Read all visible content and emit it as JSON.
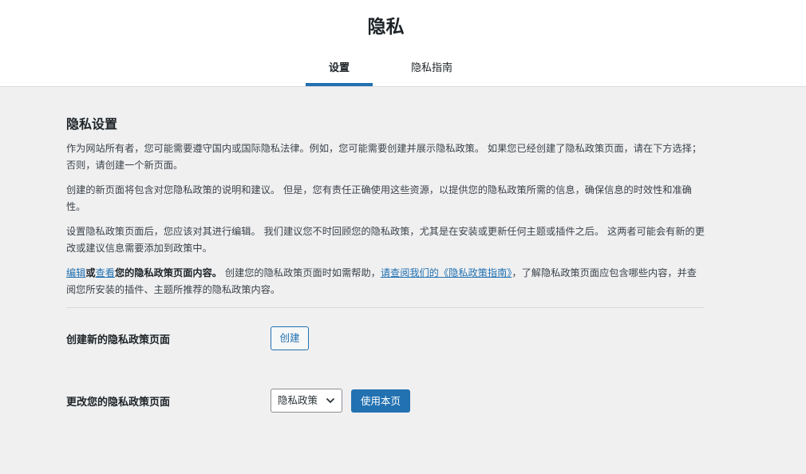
{
  "header": {
    "title": "隐私",
    "tabs": [
      {
        "label": "设置",
        "active": true
      },
      {
        "label": "隐私指南",
        "active": false
      }
    ]
  },
  "main": {
    "section_title": "隐私设置",
    "paragraph1": "作为网站所有者，您可能需要遵守国内或国际隐私法律。例如，您可能需要创建并展示隐私政策。 如果您已经创建了隐私政策页面，请在下方选择；否则，请创建一个新页面。",
    "paragraph2": "创建的新页面将包含对您隐私政策的说明和建议。 但是，您有责任正确使用这些资源，以提供您的隐私政策所需的信息，确保信息的时效性和准确性。",
    "paragraph3": "设置隐私政策页面后，您应该对其进行编辑。 我们建议您不时回顾您的隐私政策，尤其是在安装或更新任何主题或插件之后。 这两者可能会有新的更改或建议信息需要添加到政策中。",
    "paragraph4": {
      "edit_link": "编辑",
      "or_text": "或",
      "view_link": "查看",
      "bold_text": "您的隐私政策页面内容。",
      "help_text": " 创建您的隐私政策页面时如需帮助，",
      "guide_link": "请查阅我们的《隐私政策指南》",
      "tail_text": "，了解隐私政策页面应包含哪些内容，并查阅您所安装的插件、主题所推荐的隐私政策内容。"
    },
    "create_row": {
      "label": "创建新的隐私政策页面",
      "button": "创建"
    },
    "change_row": {
      "label": "更改您的隐私政策页面",
      "select_value": "隐私政策",
      "button": "使用本页"
    }
  },
  "colors": {
    "accent": "#2271b1",
    "background": "#f0f0f1",
    "header_bg": "#ffffff"
  }
}
